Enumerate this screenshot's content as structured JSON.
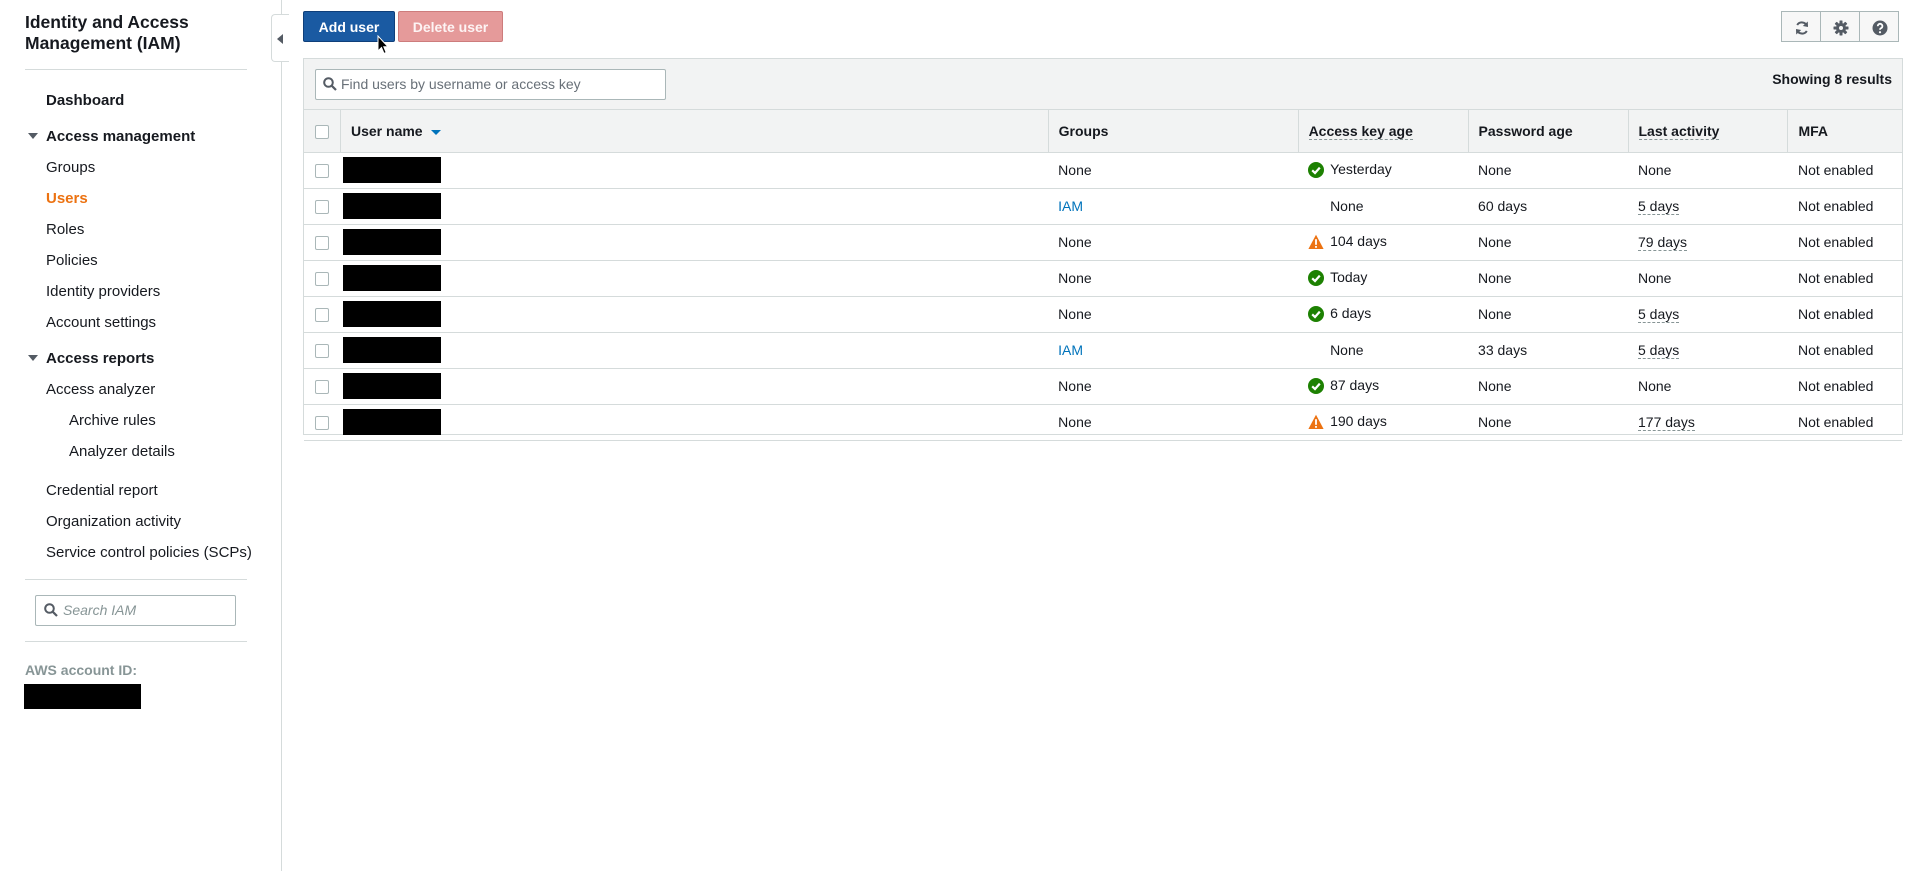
{
  "sidebar": {
    "title": "Identity and Access Management (IAM)",
    "dashboard": "Dashboard",
    "access_management": "Access management",
    "groups": "Groups",
    "users": "Users",
    "roles": "Roles",
    "policies": "Policies",
    "identity_providers": "Identity providers",
    "account_settings": "Account settings",
    "access_reports": "Access reports",
    "access_analyzer": "Access analyzer",
    "archive_rules": "Archive rules",
    "analyzer_details": "Analyzer details",
    "credential_report": "Credential report",
    "organization_activity": "Organization activity",
    "scp": "Service control policies (SCPs)",
    "search_placeholder": "Search IAM",
    "account_id_label": "AWS account ID:"
  },
  "toolbar": {
    "add_user": "Add user",
    "delete_user": "Delete user"
  },
  "filter": {
    "placeholder": "Find users by username or access key",
    "results": "Showing 8 results"
  },
  "table": {
    "headers": {
      "user_name": "User name",
      "groups": "Groups",
      "access_key_age": "Access key age",
      "password_age": "Password age",
      "last_activity": "Last activity",
      "mfa": "MFA"
    },
    "rows": [
      {
        "groups": "None",
        "group_link": false,
        "key_icon": "check-icon",
        "key_age": "Yesterday",
        "password_age": "None",
        "last_activity": "None",
        "activity_dashed": false,
        "mfa": "Not enabled"
      },
      {
        "groups": "IAM",
        "group_link": true,
        "key_icon": "",
        "key_age": "None",
        "password_age": "60 days",
        "last_activity": "5 days",
        "activity_dashed": true,
        "mfa": "Not enabled"
      },
      {
        "groups": "None",
        "group_link": false,
        "key_icon": "warning-icon",
        "key_age": "104 days",
        "password_age": "None",
        "last_activity": "79 days",
        "activity_dashed": true,
        "mfa": "Not enabled"
      },
      {
        "groups": "None",
        "group_link": false,
        "key_icon": "check-icon",
        "key_age": "Today",
        "password_age": "None",
        "last_activity": "None",
        "activity_dashed": false,
        "mfa": "Not enabled"
      },
      {
        "groups": "None",
        "group_link": false,
        "key_icon": "check-icon",
        "key_age": "6 days",
        "password_age": "None",
        "last_activity": "5 days",
        "activity_dashed": true,
        "mfa": "Not enabled"
      },
      {
        "groups": "IAM",
        "group_link": true,
        "key_icon": "",
        "key_age": "None",
        "password_age": "33 days",
        "last_activity": "5 days",
        "activity_dashed": true,
        "mfa": "Not enabled"
      },
      {
        "groups": "None",
        "group_link": false,
        "key_icon": "check-icon",
        "key_age": "87 days",
        "password_age": "None",
        "last_activity": "None",
        "activity_dashed": false,
        "mfa": "Not enabled"
      },
      {
        "groups": "None",
        "group_link": false,
        "key_icon": "warning-icon",
        "key_age": "190 days",
        "password_age": "None",
        "last_activity": "177 days",
        "activity_dashed": true,
        "mfa": "Not enabled"
      }
    ]
  },
  "colors": {
    "active_nav": "#ec7211",
    "link": "#0073bb",
    "primary_button": "#1a5aa2",
    "ok_icon": "#1d8102",
    "warning_icon": "#ec7211"
  }
}
